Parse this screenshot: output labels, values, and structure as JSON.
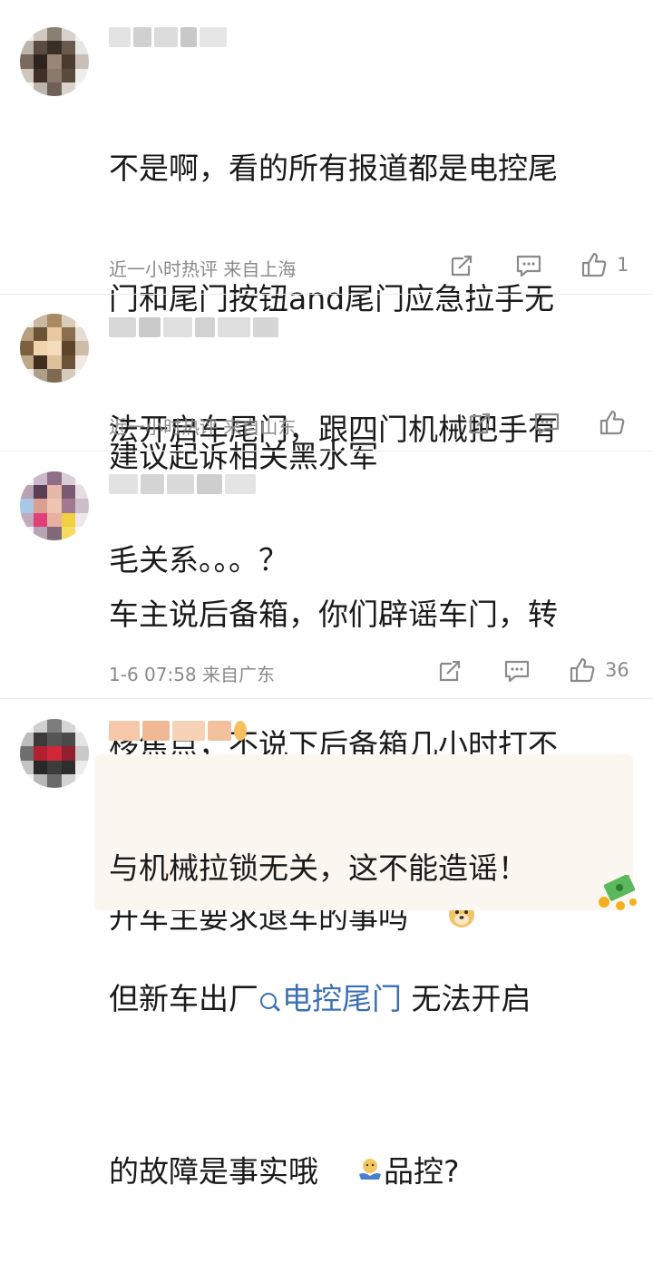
{
  "comments": [
    {
      "text": "不是啊，看的所有报道都是电控尾门和尾门按钮and尾门应急拉手无法开启车尾门，跟四门机械把手有毛关系。。。？",
      "lines": [
        "不是啊，看的所有报道都是电控尾",
        "门和尾门按钮and尾门应急拉手无",
        "法开启车尾门，跟四门机械把手有",
        "毛关系。。。？"
      ],
      "meta": "近一小时热评  来自上海",
      "likes": "1"
    },
    {
      "lines": [
        "建议起诉相关黑水军"
      ],
      "meta": "近一小时热评  来自山东",
      "likes": ""
    },
    {
      "lines": [
        "车主说后备箱，你们辟谣车门，转",
        "移焦点，不说下后备箱几小时打不",
        "开车主要求退车的事吗"
      ],
      "meta": "1-6 07:58  来自广东",
      "likes": "36"
    },
    {
      "line1": "与机械拉锁无关，这不能造谣！",
      "line2_prefix": "但新车出厂",
      "line2_link": "电控尾门",
      "line2_suffix": " 无法开启",
      "line3_prefix": "的故障是事实哦",
      "line3_suffix": "品控?"
    }
  ],
  "icons": {
    "repost": "repost-icon",
    "comment": "comment-icon",
    "like": "thumbs-up-icon",
    "search": "search-icon"
  },
  "colors": {
    "link": "#3a6fb5",
    "meta": "#8a8a8a",
    "highlight": "#fbf6ef"
  }
}
